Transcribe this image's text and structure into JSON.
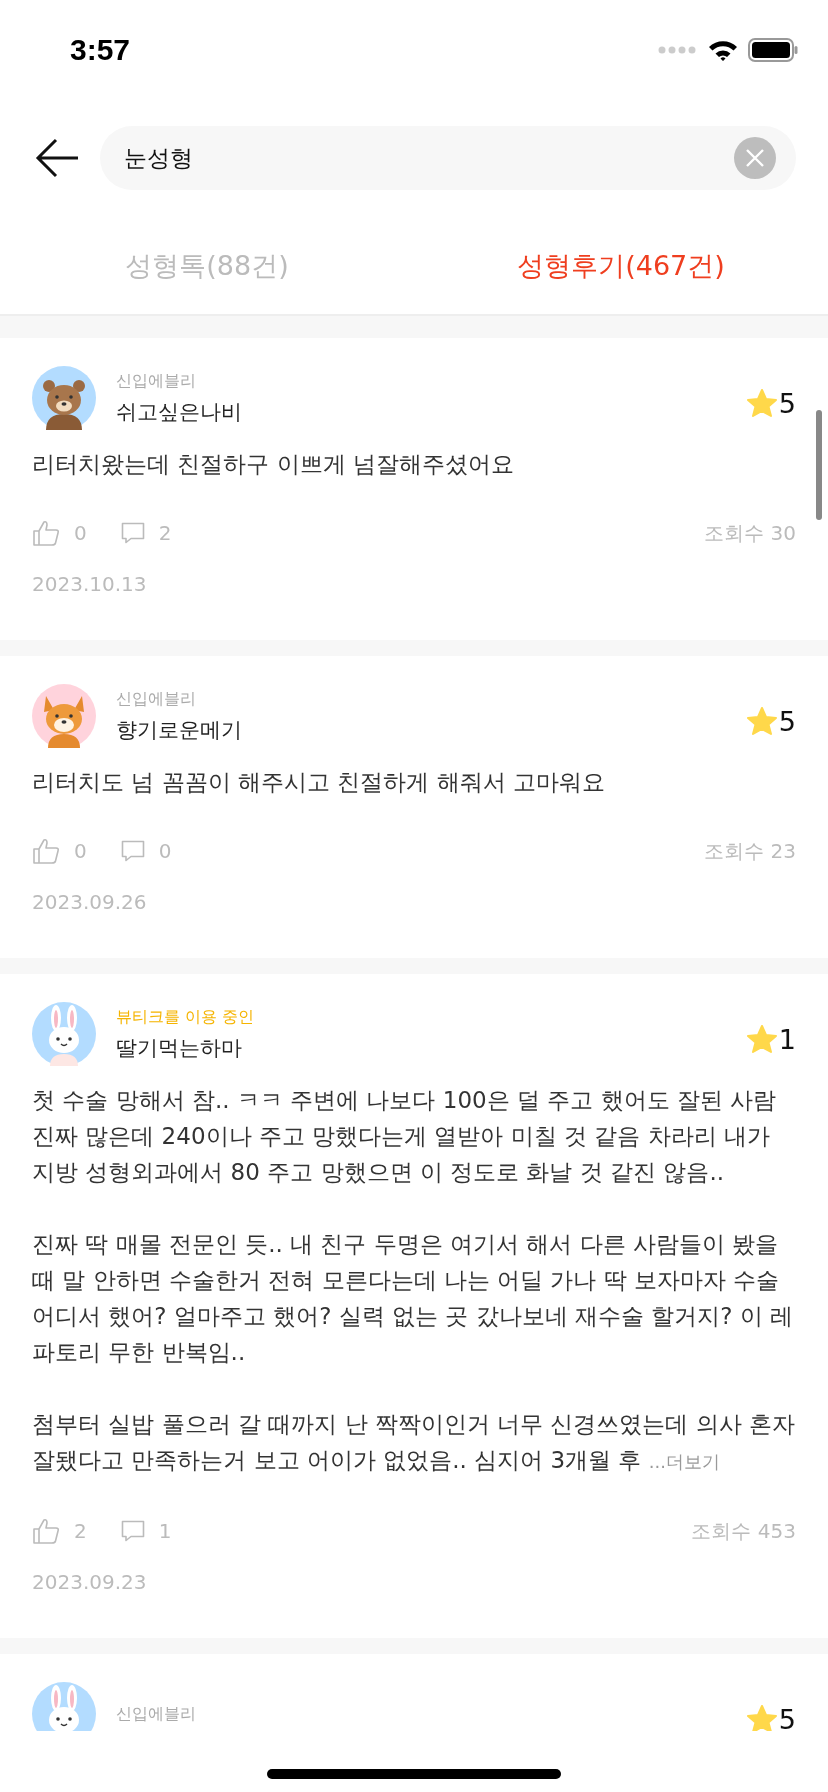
{
  "status_bar": {
    "time": "3:57"
  },
  "search": {
    "value": "눈성형"
  },
  "tabs": [
    {
      "label": "성형톡(88건)",
      "selected": false
    },
    {
      "label": "성형후기(467건)",
      "selected": true
    }
  ],
  "reviews": [
    {
      "kind": "bear",
      "badge": {
        "text": "신입에블리",
        "color": "#aaaaaa"
      },
      "nickname": "쉬고싶은나비",
      "rating": "5",
      "paragraphs": [
        "리터치왔는데 친절하구 이쁘게 넘잘해주셨어요"
      ],
      "likes": "0",
      "comments": "2",
      "views": "조회수 30",
      "date": "2023.10.13"
    },
    {
      "kind": "dog",
      "badge": {
        "text": "신입에블리",
        "color": "#aaaaaa"
      },
      "nickname": "향기로운메기",
      "rating": "5",
      "paragraphs": [
        "리터치도 넘 꼼꼼이 해주시고 친절하게 해줘서 고마워요"
      ],
      "likes": "0",
      "comments": "0",
      "views": "조회수 23",
      "date": "2023.09.26"
    },
    {
      "kind": "rabbit",
      "badge": {
        "text": "뷰티크를 이용 중인",
        "color": "#f5b400"
      },
      "nickname": "딸기먹는하마",
      "rating": "1",
      "paragraphs": [
        "첫 수술 망해서 참.. ㅋㅋ 주변에 나보다 100은 덜 주고 했어도 잘된 사람 진짜 많은데 240이나 주고 망했다는게 열받아 미칠 것 같음 차라리 내가 지방 성형외과에서 80 주고 망했으면 이 정도로 화날 것 같진 않음..",
        "진짜 딱 매몰 전문인 듯.. 내 친구 두명은 여기서 해서 다른 사람들이 봤을 때 말 안하면 수술한거 전혀 모른다는데 나는 어딜 가나 딱 보자마자 수술 어디서 했어? 얼마주고 했어? 실력 없는 곳 갔나보네 재수술 할거지? 이 레파토리 무한 반복임..",
        "첨부터 실밥 풀으러 갈 때까지 난 짝짝이인거 너무 신경쓰였는데 의사 혼자 잘됐다고 만족하는거 보고 어이가 없었음.. 심지어 3개월 후"
      ],
      "more": "...더보기",
      "likes": "2",
      "comments": "1",
      "views": "조회수 453",
      "date": "2023.09.23"
    },
    {
      "kind": "rabbit",
      "badge": {
        "text": "신입에블리",
        "color": "#aaaaaa"
      },
      "rating": "5"
    }
  ]
}
